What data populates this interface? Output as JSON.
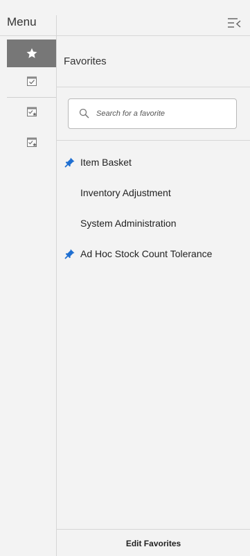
{
  "header": {
    "title": "Menu",
    "collapse_icon": "collapse-menu-icon"
  },
  "rail": {
    "items": [
      {
        "icon": "star-icon",
        "active": true
      },
      {
        "icon": "task-check-icon",
        "active": false
      },
      {
        "icon": "task-star-icon",
        "active": false
      },
      {
        "icon": "task-star-icon",
        "active": false
      }
    ]
  },
  "panel": {
    "title": "Favorites",
    "search": {
      "placeholder": "Search for a favorite",
      "value": ""
    },
    "favorites": [
      {
        "label": "Item Basket",
        "pinned": true
      },
      {
        "label": "Inventory Adjustment",
        "pinned": false
      },
      {
        "label": "System Administration",
        "pinned": false
      },
      {
        "label": "Ad Hoc Stock Count Tolerance",
        "pinned": true
      }
    ],
    "footer": {
      "edit_label": "Edit Favorites"
    }
  },
  "colors": {
    "active_rail": "#777777",
    "pin_blue": "#1f6fd1",
    "background": "#f3f3f3",
    "divider": "#d6d6d6"
  }
}
